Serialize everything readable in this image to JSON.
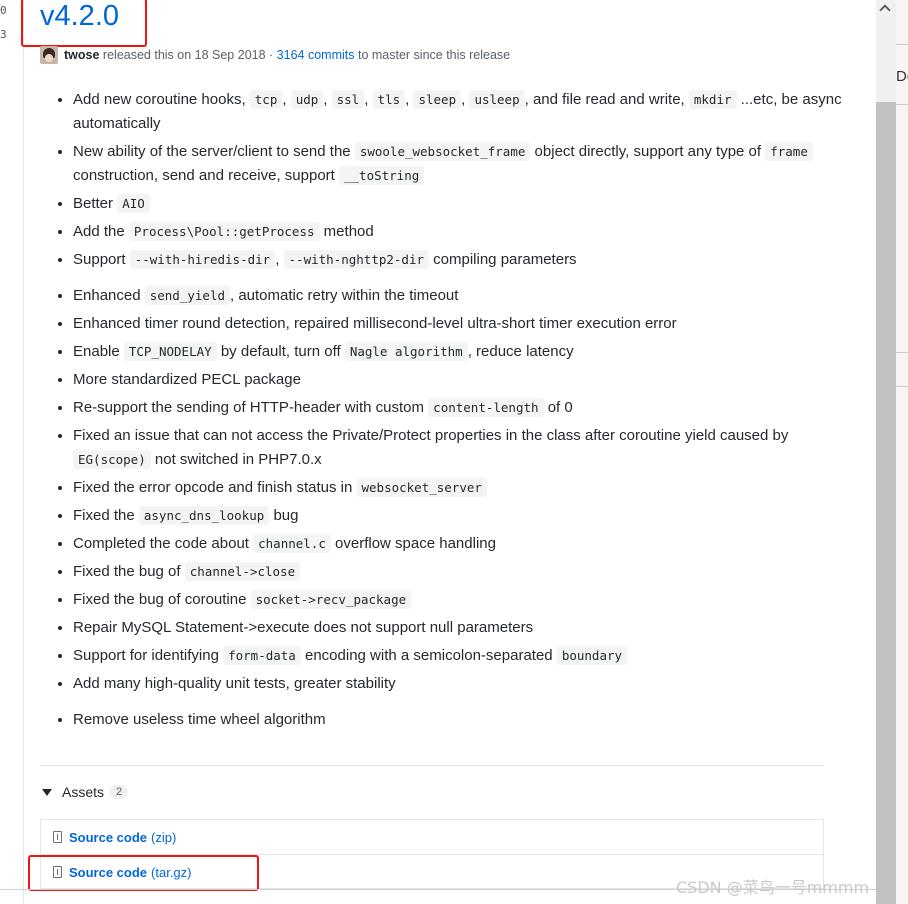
{
  "gutter": {
    "lines": [
      "0",
      "3"
    ]
  },
  "release": {
    "title": "v4.2.0"
  },
  "meta": {
    "author": "twose",
    "released_text": "released this on 18 Sep 2018 ·",
    "commits": "3164 commits",
    "since_text": "to master since this release"
  },
  "notes": [
    [
      {
        "t": "Add new coroutine hooks, "
      },
      {
        "c": "tcp"
      },
      {
        "t": ", "
      },
      {
        "c": "udp"
      },
      {
        "t": ", "
      },
      {
        "c": "ssl"
      },
      {
        "t": ", "
      },
      {
        "c": "tls"
      },
      {
        "t": ", "
      },
      {
        "c": "sleep"
      },
      {
        "t": ", "
      },
      {
        "c": "usleep"
      },
      {
        "t": ", and file read and write, "
      },
      {
        "c": "mkdir"
      },
      {
        "t": " ...etc, be async automatically"
      }
    ],
    [
      {
        "t": "New ability of the server/client to send the "
      },
      {
        "c": "swoole_websocket_frame"
      },
      {
        "t": " object directly, support any type of "
      },
      {
        "c": "frame"
      },
      {
        "t": " construction, send and receive, support "
      },
      {
        "c": "__toString"
      }
    ],
    [
      {
        "t": "Better "
      },
      {
        "c": "AIO"
      }
    ],
    [
      {
        "t": "Add the "
      },
      {
        "c": "Process\\Pool::getProcess"
      },
      {
        "t": " method"
      }
    ],
    [
      {
        "t": "Support "
      },
      {
        "c": "--with-hiredis-dir"
      },
      {
        "t": ", "
      },
      {
        "c": "--with-nghttp2-dir"
      },
      {
        "t": " compiling parameters"
      }
    ],
    [
      {
        "t": "Enhanced "
      },
      {
        "c": "send_yield"
      },
      {
        "t": ", automatic retry within the timeout"
      }
    ],
    [
      {
        "t": "Enhanced timer round detection, repaired millisecond-level ultra-short timer execution error"
      }
    ],
    [
      {
        "t": "Enable "
      },
      {
        "c": "TCP_NODELAY"
      },
      {
        "t": " by default, turn off "
      },
      {
        "c": "Nagle algorithm"
      },
      {
        "t": ", reduce latency"
      }
    ],
    [
      {
        "t": "More standardized PECL package"
      }
    ],
    [
      {
        "t": "Re-support the sending of HTTP-header with custom "
      },
      {
        "c": "content-length"
      },
      {
        "t": " of 0"
      }
    ],
    [
      {
        "t": "Fixed an issue that can not access the Private/Protect properties in the class after coroutine yield caused by "
      },
      {
        "c": "EG(scope)"
      },
      {
        "t": " not switched in PHP7.0.x"
      }
    ],
    [
      {
        "t": "Fixed the error opcode and finish status in "
      },
      {
        "c": "websocket_server"
      }
    ],
    [
      {
        "t": "Fixed the "
      },
      {
        "c": "async_dns_lookup"
      },
      {
        "t": " bug"
      }
    ],
    [
      {
        "t": "Completed the code about "
      },
      {
        "c": "channel.c"
      },
      {
        "t": " overflow space handling"
      }
    ],
    [
      {
        "t": "Fixed the bug of "
      },
      {
        "c": "channel->close"
      }
    ],
    [
      {
        "t": "Fixed the bug of coroutine "
      },
      {
        "c": "socket->recv_package"
      }
    ],
    [
      {
        "t": "Repair MySQL Statement->execute does not support null parameters"
      }
    ],
    [
      {
        "t": "Support for identifying "
      },
      {
        "c": "form-data"
      },
      {
        "t": " encoding with a semicolon-separated "
      },
      {
        "c": "boundary"
      }
    ],
    [
      {
        "t": "Add many high-quality unit tests, greater stability"
      }
    ],
    [
      {
        "t": "Remove useless time wheel algorithm"
      }
    ]
  ],
  "assets": {
    "label": "Assets",
    "count": "2",
    "items": [
      {
        "name": "Source code",
        "suffix": "(zip)"
      },
      {
        "name": "Source code",
        "suffix": "(tar.gz)"
      }
    ]
  },
  "right_panel": {
    "text": "De"
  },
  "watermark": "CSDN @菜鸟一号mmmm",
  "colors": {
    "link": "#0366d6",
    "highlight": "#f01414",
    "text": "#24292e",
    "muted": "#586069"
  }
}
